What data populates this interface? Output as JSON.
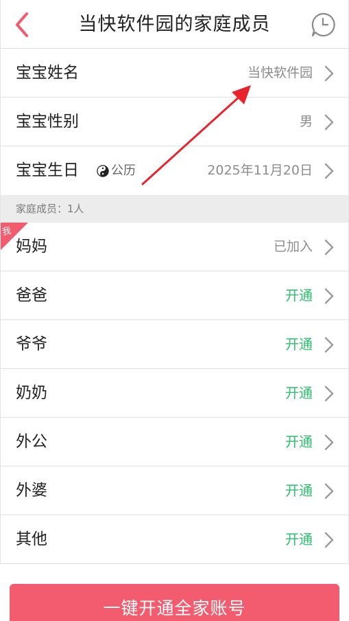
{
  "header": {
    "title": "当快软件园的家庭成员",
    "back_icon": "chevron-left-icon",
    "history_icon": "clock-bubble-icon",
    "accent": "#f25c6e"
  },
  "baby": {
    "name_label": "宝宝姓名",
    "name_value": "当快软件园",
    "gender_label": "宝宝性别",
    "gender_value": "男",
    "birthday_label": "宝宝生日",
    "calendar_type": "公历",
    "calendar_icon": "yin-yang-icon",
    "birthday_value": "2025年11月20日"
  },
  "family": {
    "count_text": "家庭成员：1人",
    "me_badge": "我",
    "members": [
      {
        "label": "妈妈",
        "status": "已加入"
      },
      {
        "label": "爸爸",
        "status": "开通"
      },
      {
        "label": "爷爷",
        "status": "开通"
      },
      {
        "label": "奶奶",
        "status": "开通"
      },
      {
        "label": "外公",
        "status": "开通"
      },
      {
        "label": "外婆",
        "status": "开通"
      },
      {
        "label": "其他",
        "status": "开通"
      }
    ]
  },
  "cta": {
    "label": "一键开通全家账号",
    "color": "#f25c6e"
  },
  "colors": {
    "status_green": "#2bbf6e",
    "annotation_red": "#e8232b"
  }
}
